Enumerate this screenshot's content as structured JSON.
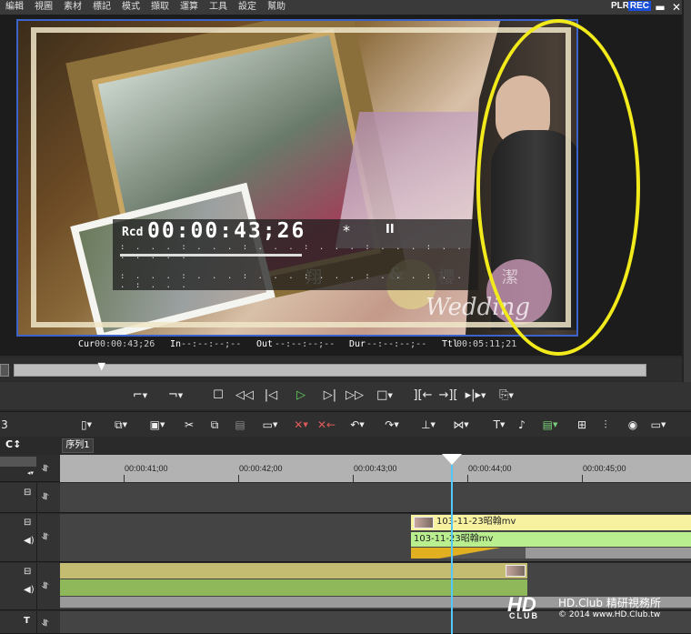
{
  "menu": [
    "編輯",
    "視圖",
    "素材",
    "標記",
    "模式",
    "擷取",
    "運算",
    "工具",
    "設定",
    "幫助"
  ],
  "mode": {
    "plr": "PLR",
    "rec": "REC"
  },
  "window_buttons": {
    "minimize": "▬",
    "close": "✕"
  },
  "preview": {
    "overlay_label": "Rcd",
    "timecode": "00:00:43;26",
    "star": "*",
    "pause": "II",
    "caption_wedding": "Wedding",
    "caption_chars": [
      "翔",
      "&",
      "櫻",
      "潔"
    ]
  },
  "status": {
    "cur_label": "Cur",
    "cur_value": "00:00:43;26",
    "in_label": "In",
    "in_value": "--:--:--;--",
    "out_label": "Out",
    "out_value": "--:--:--;--",
    "dur_label": "Dur",
    "dur_value": "--:--:--;--",
    "ttl_label": "Ttl",
    "ttl_value": "00:05:11;21"
  },
  "position_bar": {
    "fraction": 0.14
  },
  "sequence": {
    "tab": "序列1",
    "tab_icon": "C↕"
  },
  "ruler": {
    "labels": [
      "00:00:41;00",
      "00:00:42;00",
      "00:00:43;00",
      "00:00:44;00",
      "00:00:45;00"
    ]
  },
  "tracks": {
    "clip_video_name": "103-11-23昭翰mv",
    "clip_audio_name": "103-11-23昭翰mv"
  },
  "watermark": {
    "logo": "HD",
    "club": "CLUB",
    "brand": "HD.Club 精研視務所",
    "copyright": "© 2014  www.HD.Club.tw"
  },
  "colors": {
    "annotation": "#f2ea1b",
    "playhead": "#52c8ff",
    "video_clip": "#f7f2a0",
    "audio_clip": "#b9ef8f"
  }
}
